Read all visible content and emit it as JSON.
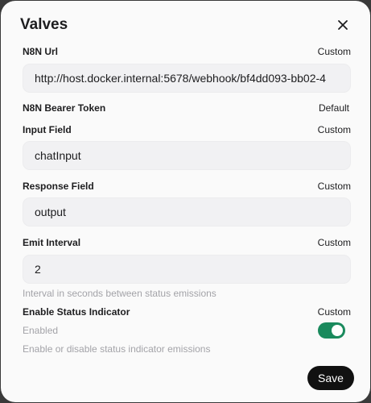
{
  "dialog": {
    "title": "Valves",
    "close_icon": "close-icon"
  },
  "fields": [
    {
      "label": "N8N Url",
      "mode": "Custom",
      "value": "http://host.docker.internal:5678/webhook/bf4dd093-bb02-4"
    },
    {
      "label": "N8N Bearer Token",
      "mode": "Default"
    },
    {
      "label": "Input Field",
      "mode": "Custom",
      "value": "chatInput"
    },
    {
      "label": "Response Field",
      "mode": "Custom",
      "value": "output"
    },
    {
      "label": "Emit Interval",
      "mode": "Custom",
      "value": "2",
      "help": "Interval in seconds between status emissions"
    },
    {
      "label": "Enable Status Indicator",
      "mode": "Custom",
      "state_label": "Enabled",
      "enabled": true,
      "help": "Enable or disable status indicator emissions"
    }
  ],
  "actions": {
    "save_label": "Save"
  },
  "colors": {
    "toggle_on": "#1a8a5d",
    "save_button": "#111111"
  }
}
